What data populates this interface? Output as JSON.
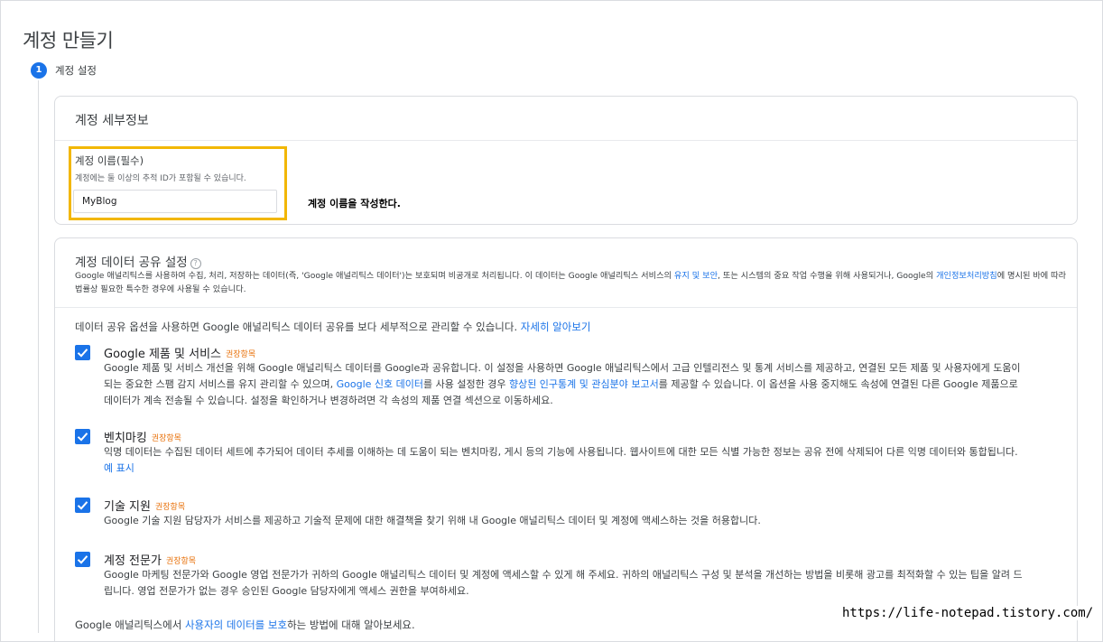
{
  "page": {
    "title": "계정 만들기"
  },
  "stepper": {
    "step_number": "1",
    "step_label": "계정 설정"
  },
  "account_details": {
    "header": "계정 세부정보",
    "name_label": "계정 이름(필수)",
    "name_help": "계정에는 둘 이상의 추적 ID가 포함될 수 있습니다.",
    "name_value": "MyBlog",
    "annotation": "계정 이름을 작성한다."
  },
  "data_sharing": {
    "header": "계정 데이터 공유 설정",
    "help_icon": "?",
    "desc_part1": "Google 애널리틱스를 사용하여 수집, 처리, 저장하는 데이터(즉, 'Google 애널리틱스 데이터')는 보호되며 비공개로 처리됩니다. 이 데이터는 Google 애널리틱스 서비스의 ",
    "desc_link1": "유지 및 보안",
    "desc_part2": ", 또는 시스템의 중요 작업 수행을 위해 사용되거나, Google의 ",
    "desc_link2": "개인정보처리방침",
    "desc_part3": "에 명시된 바에 따라 법률상 필요한 특수한 경우에 사용될 수 있습니다.",
    "intro": "데이터 공유 옵션을 사용하면 Google 애널리틱스 데이터 공유를 보다 세부적으로 관리할 수 있습니다. ",
    "intro_link": "자세히 알아보기",
    "options": [
      {
        "title": "Google 제품 및 서비스",
        "badge": "권장항목",
        "desc_a": "Google 제품 및 서비스 개선을 위해 Google 애널리틱스 데이터를 Google과 공유합니다. 이 설정을 사용하면 Google 애널리틱스에서 고급 인텔리전스 및 통계 서비스를 제공하고, 연결된 모든 제품 및 사용자에게 도움이 되는 중요한 스팸 감지 서비스를 유지 관리할 수 있으며, ",
        "link_a": "Google 신호 데이터",
        "desc_b": "를 사용 설정한 경우 ",
        "link_b": "향상된 인구통계 및 관심분야 보고서",
        "desc_c": "를 제공할 수 있습니다. 이 옵션을 사용 중지해도 속성에 연결된 다른 Google 제품으로 데이터가 계속 전송될 수 있습니다. 설정을 확인하거나 변경하려면 각 속성의 제품 연결 섹션으로 이동하세요."
      },
      {
        "title": "벤치마킹",
        "badge": "권장항목",
        "desc_a": "익명 데이터는 수집된 데이터 세트에 추가되어 데이터 추세를 이해하는 데 도움이 되는 벤치마킹, 게시 등의 기능에 사용됩니다. 웹사이트에 대한 모든 식별 가능한 정보는 공유 전에 삭제되어 다른 익명 데이터와 통합됩니다. ",
        "link_a": "예 표시"
      },
      {
        "title": "기술 지원",
        "badge": "권장항목",
        "desc_a": "Google 기술 지원 담당자가 서비스를 제공하고 기술적 문제에 대한 해결책을 찾기 위해 내 Google 애널리틱스 데이터 및 계정에 액세스하는 것을 허용합니다."
      },
      {
        "title": "계정 전문가",
        "badge": "권장항목",
        "desc_a": "Google 마케팅 전문가와 Google 영업 전문가가 귀하의 Google 애널리틱스 데이터 및 계정에 액세스할 수 있게 해 주세요. 귀하의 애널리틱스 구성 및 분석을 개선하는 방법을 비롯해 광고를 최적화할 수 있는 팁을 알려 드립니다. 영업 전문가가 없는 경우 승인된 Google 담당자에게 액세스 권한을 부여하세요."
      }
    ],
    "footer_a": "Google 애널리틱스에서 ",
    "footer_link": "사용자의 데이터를 보호",
    "footer_b": "하는 방법에 대해 알아보세요."
  },
  "watermark": "https://life-notepad.tistory.com/",
  "colors": {
    "accent": "#1a73e8",
    "highlight": "#f2b705",
    "badge": "#e8710a"
  },
  "icons": {
    "checkbox": "check-icon",
    "help": "help-circle-icon"
  }
}
